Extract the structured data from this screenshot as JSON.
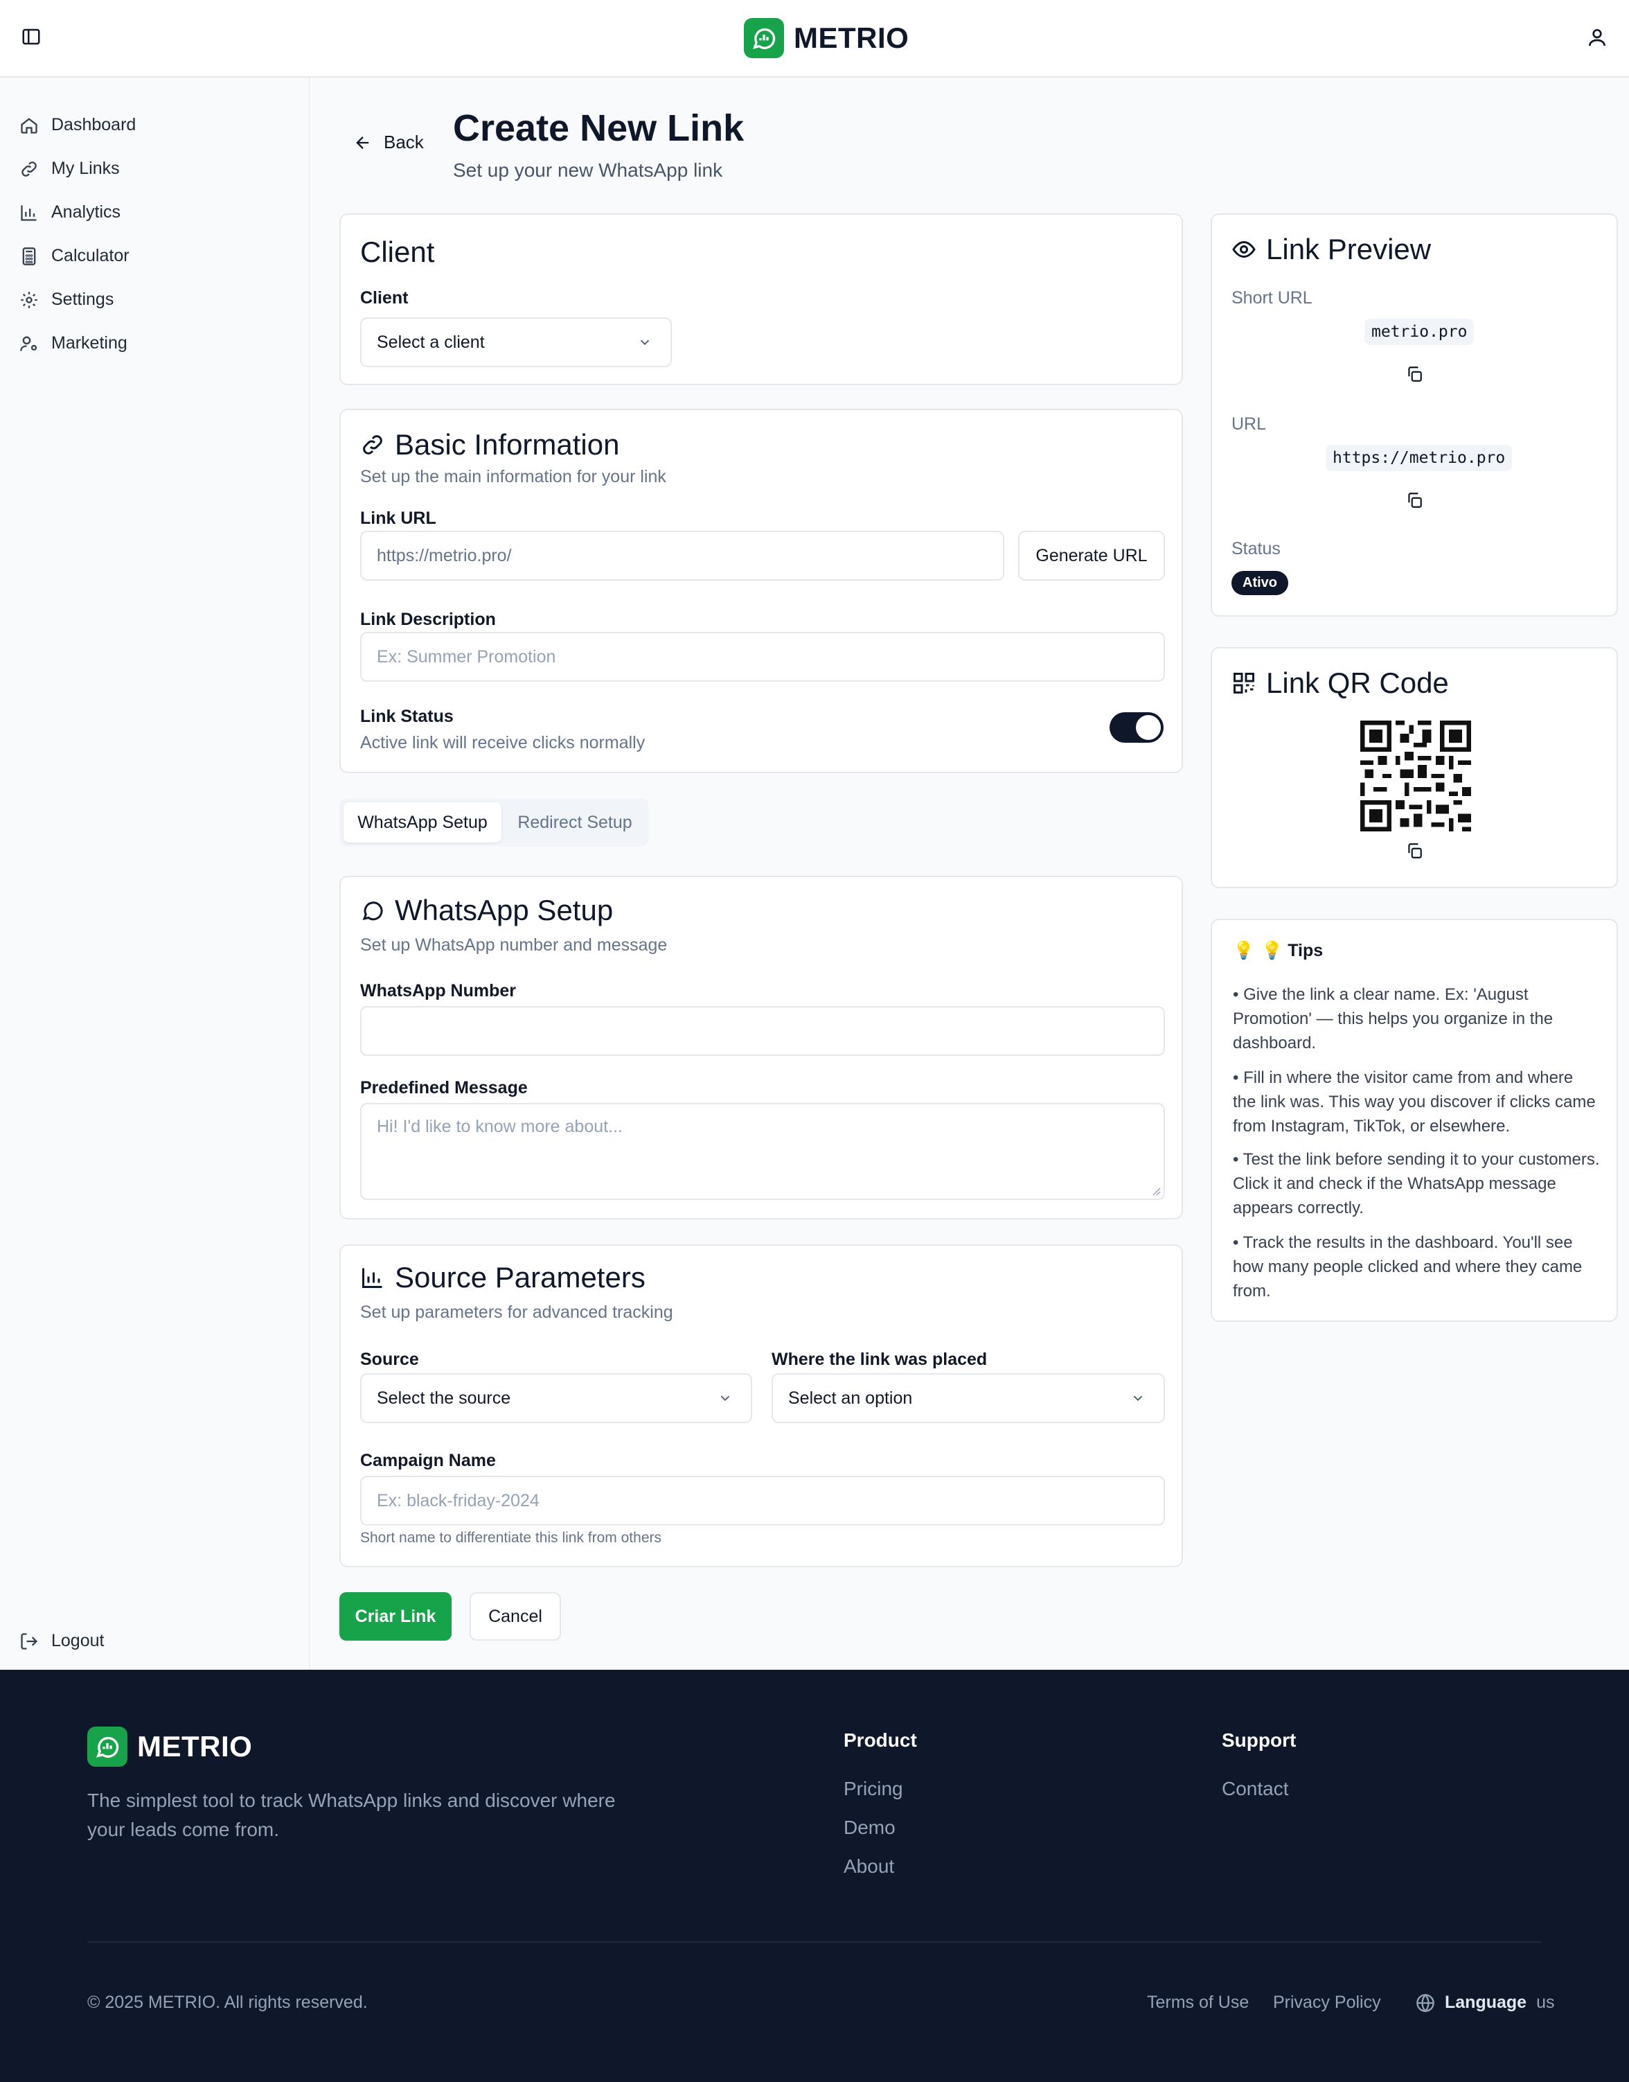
{
  "brand": {
    "name": "METRIO"
  },
  "sidebar": {
    "items": [
      {
        "label": "Dashboard"
      },
      {
        "label": "My Links"
      },
      {
        "label": "Analytics"
      },
      {
        "label": "Calculator"
      },
      {
        "label": "Settings"
      },
      {
        "label": "Marketing"
      }
    ],
    "logout": "Logout"
  },
  "page": {
    "back_label": "Back",
    "title": "Create New Link",
    "subtitle": "Set up your new WhatsApp link"
  },
  "client_card": {
    "title": "Client",
    "label": "Client",
    "select_value": "Select a client"
  },
  "basic_info": {
    "title": "Basic Information",
    "description": "Set up the main information for your link",
    "url_label": "Link URL",
    "url_placeholder": "https://metrio.pro/",
    "generate_label": "Generate URL",
    "desc_label": "Link Description",
    "desc_placeholder": "Ex: Summer Promotion",
    "status_label": "Link Status",
    "status_help": "Active link will receive clicks normally",
    "status_on": true
  },
  "tabs": [
    {
      "label": "WhatsApp Setup",
      "active": true
    },
    {
      "label": "Redirect Setup",
      "active": false
    }
  ],
  "whatsapp": {
    "title": "WhatsApp Setup",
    "description": "Set up WhatsApp number and message",
    "number_label": "WhatsApp Number",
    "number_value": "",
    "message_label": "Predefined Message",
    "message_placeholder": "Hi! I'd like to know more about..."
  },
  "source": {
    "title": "Source Parameters",
    "description": "Set up parameters for advanced tracking",
    "source_label": "Source",
    "source_value": "Select the source",
    "placed_label": "Where the link was placed",
    "placed_value": "Select an option",
    "campaign_label": "Campaign Name",
    "campaign_placeholder": "Ex: black-friday-2024",
    "campaign_help": "Short name to differentiate this link from others"
  },
  "actions": {
    "create_label": "Criar Link",
    "cancel_label": "Cancel"
  },
  "preview": {
    "title": "Link Preview",
    "short_url_label": "Short URL",
    "short_url": "metrio.pro",
    "url_label": "URL",
    "url": "https://metrio.pro",
    "status_label": "Status",
    "status_value": "Ativo"
  },
  "qr": {
    "title": "Link QR Code"
  },
  "tips": {
    "title": "💡 Tips",
    "items": [
      "• Give the link a clear name. Ex: 'August Promotion' — this helps you organize in the dashboard.",
      "• Fill in where the visitor came from and where the link was. This way you discover if clicks came from Instagram, TikTok, or elsewhere.",
      "• Test the link before sending it to your customers. Click it and check if the WhatsApp message appears correctly.",
      "• Track the results in the dashboard. You'll see how many people clicked and where they came from."
    ]
  },
  "footer": {
    "tagline": "The simplest tool to track WhatsApp links and discover where your leads come from.",
    "product_heading": "Product",
    "product_links": [
      "Pricing",
      "Demo",
      "About"
    ],
    "support_heading": "Support",
    "support_links": [
      "Contact"
    ],
    "copyright": "© 2025 METRIO. All rights reserved.",
    "terms": "Terms of Use",
    "privacy": "Privacy Policy",
    "language_label": "Language",
    "language_value": "us"
  },
  "colors": {
    "brand_green": "#16a34a",
    "dark_navy": "#0f172a",
    "muted_text": "#64748b",
    "border": "#e5e7eb"
  }
}
